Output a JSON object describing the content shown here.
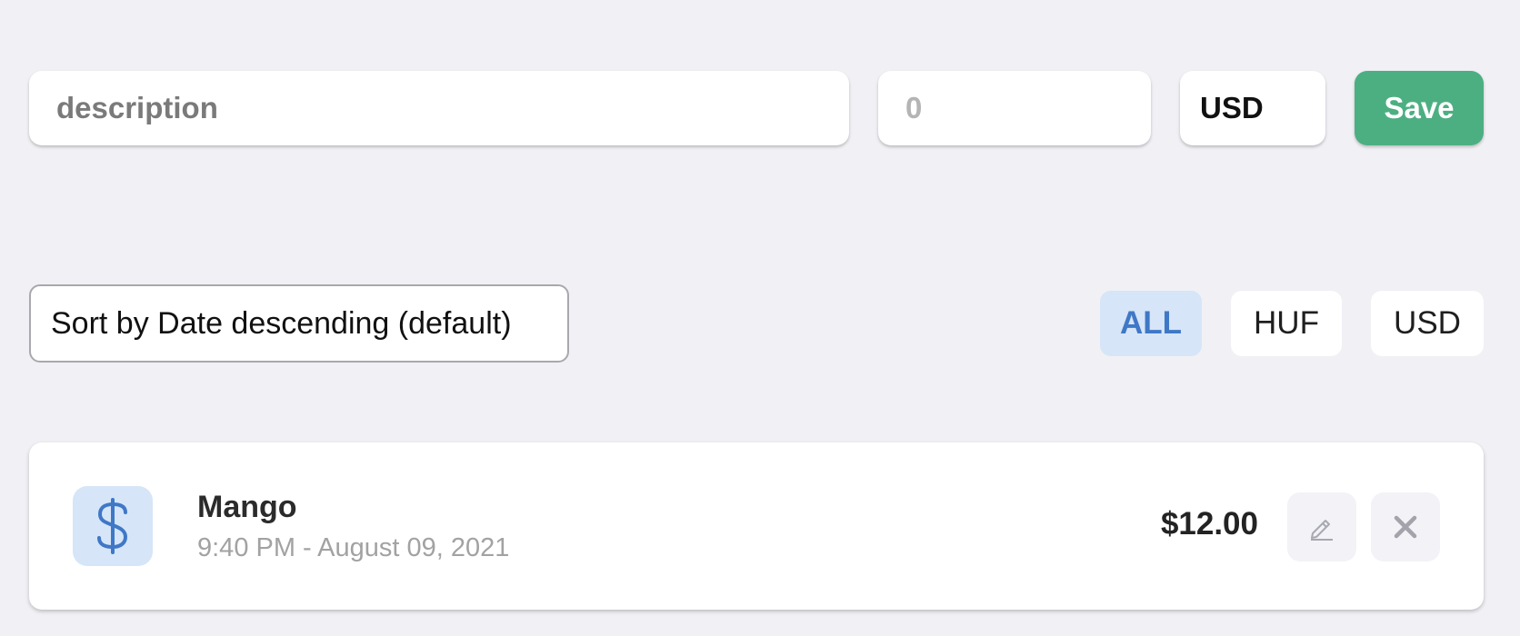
{
  "form": {
    "description_placeholder": "description",
    "amount_placeholder": "0",
    "currency_value": "USD",
    "save_label": "Save"
  },
  "sort": {
    "selected_label": "Sort by Date descending (default)"
  },
  "filters": {
    "items": [
      {
        "label": "ALL",
        "active": true
      },
      {
        "label": "HUF",
        "active": false
      },
      {
        "label": "USD",
        "active": false
      }
    ]
  },
  "expenses": {
    "items": [
      {
        "icon": "dollar-icon",
        "title": "Mango",
        "date": "9:40 PM - August 09, 2021",
        "amount": "$12.00"
      }
    ]
  },
  "colors": {
    "background": "#f0f0f5",
    "save_button": "#4caf82",
    "accent_blue": "#3f78c6",
    "accent_blue_light": "#d6e5f8"
  }
}
